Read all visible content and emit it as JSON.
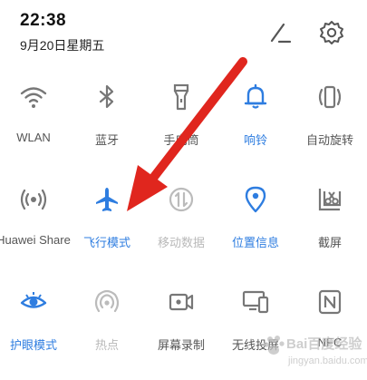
{
  "status": {
    "time": "22:38",
    "date": "9月20日星期五"
  },
  "header": {
    "edit_icon": "pencil-icon",
    "settings_icon": "gear-icon"
  },
  "tiles": [
    {
      "label": "WLAN",
      "icon": "wifi-icon",
      "state": "off"
    },
    {
      "label": "蓝牙",
      "icon": "bluetooth-icon",
      "state": "off"
    },
    {
      "label": "手电筒",
      "icon": "flashlight-icon",
      "state": "off"
    },
    {
      "label": "响铃",
      "icon": "bell-icon",
      "state": "on"
    },
    {
      "label": "自动旋转",
      "icon": "rotate-icon",
      "state": "off"
    },
    {
      "label": "Huawei Share",
      "icon": "share-icon",
      "state": "off"
    },
    {
      "label": "飞行模式",
      "icon": "airplane-icon",
      "state": "on"
    },
    {
      "label": "移动数据",
      "icon": "mobile-data-icon",
      "state": "disabled"
    },
    {
      "label": "位置信息",
      "icon": "location-icon",
      "state": "on"
    },
    {
      "label": "截屏",
      "icon": "scissors-icon",
      "state": "off"
    },
    {
      "label": "护眼模式",
      "icon": "eye-icon",
      "state": "on"
    },
    {
      "label": "热点",
      "icon": "hotspot-icon",
      "state": "disabled"
    },
    {
      "label": "屏幕录制",
      "icon": "screen-record-icon",
      "state": "off"
    },
    {
      "label": "无线投屏",
      "icon": "wireless-projection-icon",
      "state": "off"
    },
    {
      "label": "NFC",
      "icon": "nfc-icon",
      "state": "off"
    }
  ],
  "colors": {
    "accent": "#2e7de0",
    "icon": "#666666",
    "disabled": "#bbbbbb",
    "arrow": "#e0261e"
  },
  "watermark": {
    "text": "Bai百度经验",
    "sub": "jingyan.baidu.com",
    "icon": "baidu-paw-logo"
  }
}
